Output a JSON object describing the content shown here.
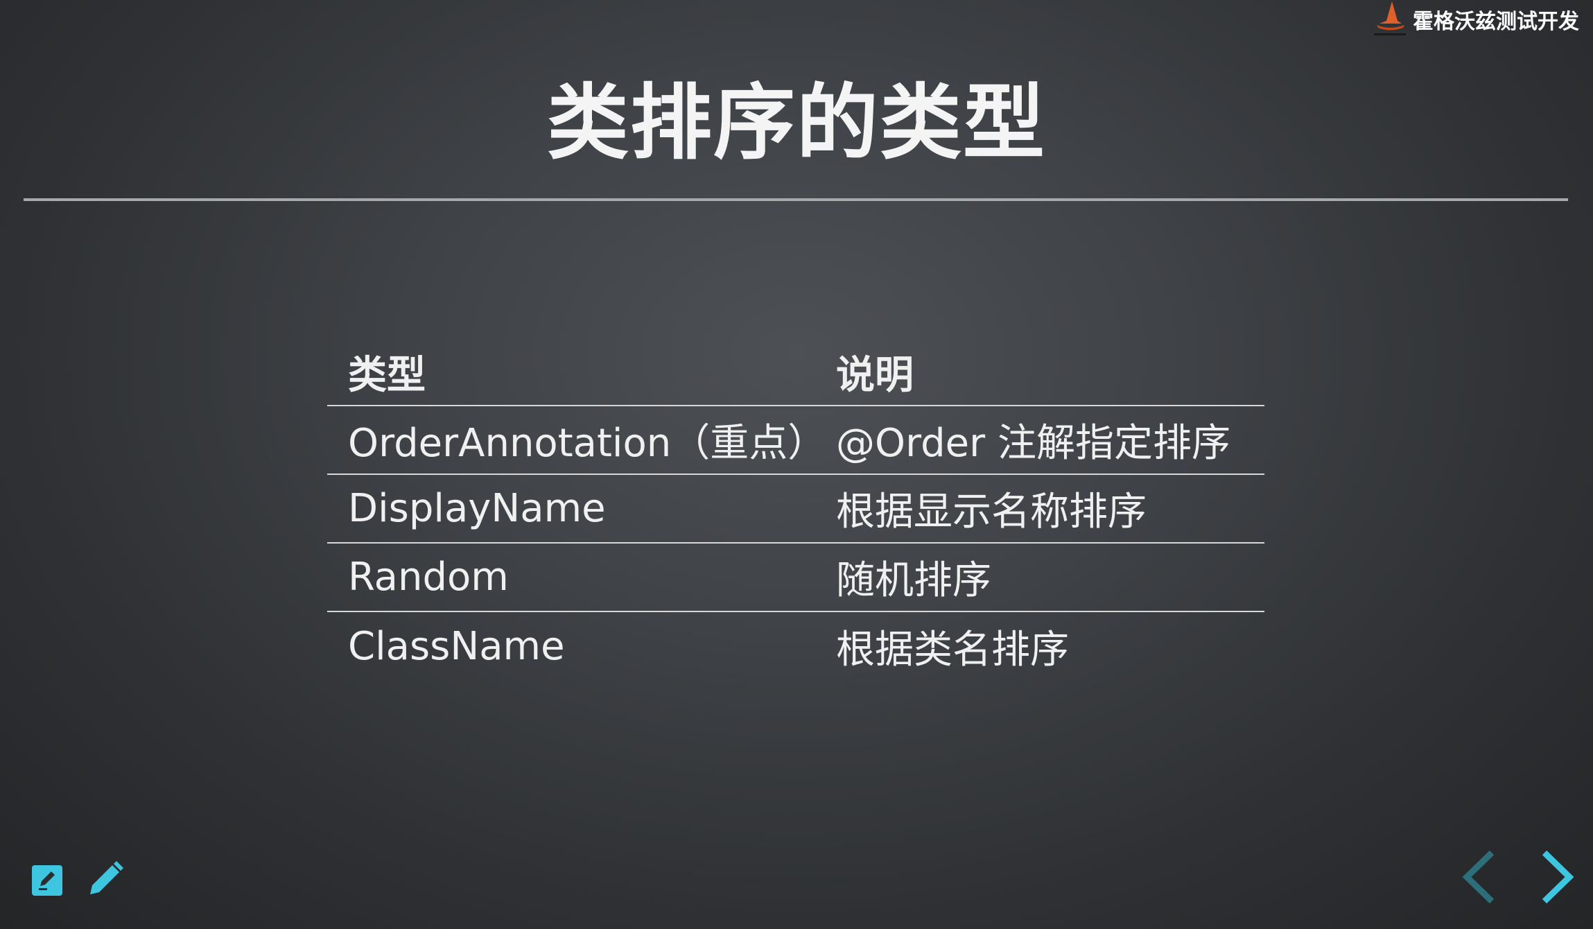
{
  "brand": {
    "name": "霍格沃兹测试开发",
    "logo_icon": "wizard-hat-icon",
    "accent": "#e0602a"
  },
  "slide": {
    "title": "类排序的类型"
  },
  "table": {
    "headers": [
      "类型",
      "说明"
    ],
    "rows": [
      [
        "OrderAnnotation（重点）",
        "@Order 注解指定排序"
      ],
      [
        "DisplayName",
        "根据显示名称排序"
      ],
      [
        "Random",
        "随机排序"
      ],
      [
        "ClassName",
        "根据类名排序"
      ]
    ]
  },
  "toolbar": {
    "edit_icon": "edit-note-icon",
    "pen_icon": "pencil-icon",
    "color": "#3ec6e0"
  },
  "navigation": {
    "prev_icon": "chevron-left-icon",
    "next_icon": "chevron-right-icon",
    "prev_color": "#2c6e7a",
    "next_color": "#3ec6e0"
  }
}
